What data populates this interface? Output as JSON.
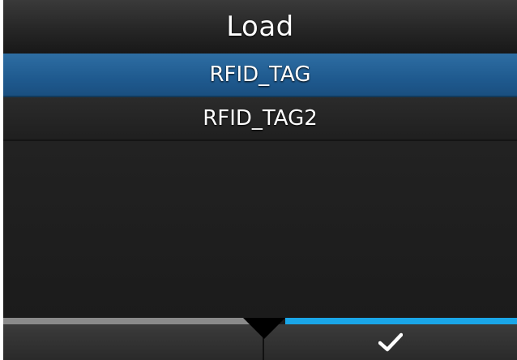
{
  "header": {
    "title": "Load"
  },
  "list": {
    "items": [
      {
        "label": "RFID_TAG",
        "selected": true
      },
      {
        "label": "RFID_TAG2",
        "selected": false
      }
    ]
  },
  "footer": {
    "left_button": {
      "icon": "blank"
    },
    "right_button": {
      "icon": "checkmark-icon"
    }
  },
  "colors": {
    "selection": "#2366a0",
    "accent_bar": "#1aa6e8",
    "inactive_bar": "#8a8a8a",
    "background": "#1c1c1c"
  }
}
